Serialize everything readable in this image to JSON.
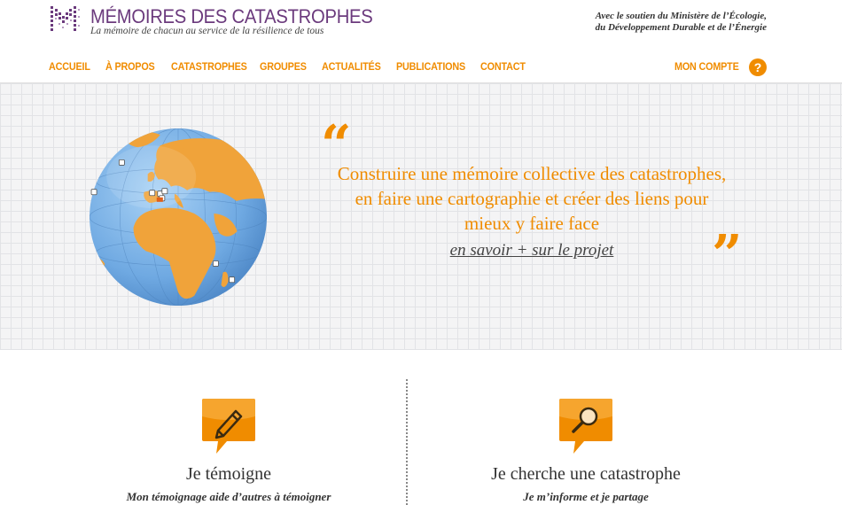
{
  "site": {
    "title": "MÉMOIRES DES CATASTROPHES",
    "tagline": "La mémoire de chacun au service de la résilience de tous",
    "support_line1": "Avec le soutien du Ministère de l’Écologie,",
    "support_line2": "du Développement Durable et de l’Énergie"
  },
  "nav": {
    "items": [
      "ACCUEIL",
      "À PROPOS",
      "CATASTROPHES",
      "GROUPES",
      "ACTUALITÉS",
      "PUBLICATIONS",
      "CONTACT"
    ],
    "account": "MON COMPTE",
    "help": "?"
  },
  "hero": {
    "quote_open": "“",
    "quote_close": "”",
    "line1": "Construire une mémoire collective des catastrophes,",
    "line2": "en faire une cartographie et créer des liens pour",
    "line3": "mieux y faire face",
    "link": "en savoir + sur le projet"
  },
  "actions": [
    {
      "title": "Je témoigne",
      "subtitle": "Mon témoignage aide d’autres à témoigner",
      "icon": "pencil-icon"
    },
    {
      "title": "Je cherche une catastrophe",
      "subtitle": "Je m’informe et je partage",
      "icon": "magnifier-icon"
    }
  ],
  "colors": {
    "accent": "#f08c00",
    "brand": "#6b3a7d",
    "ocean": "#7cb4e8",
    "land": "#f0a33a"
  }
}
